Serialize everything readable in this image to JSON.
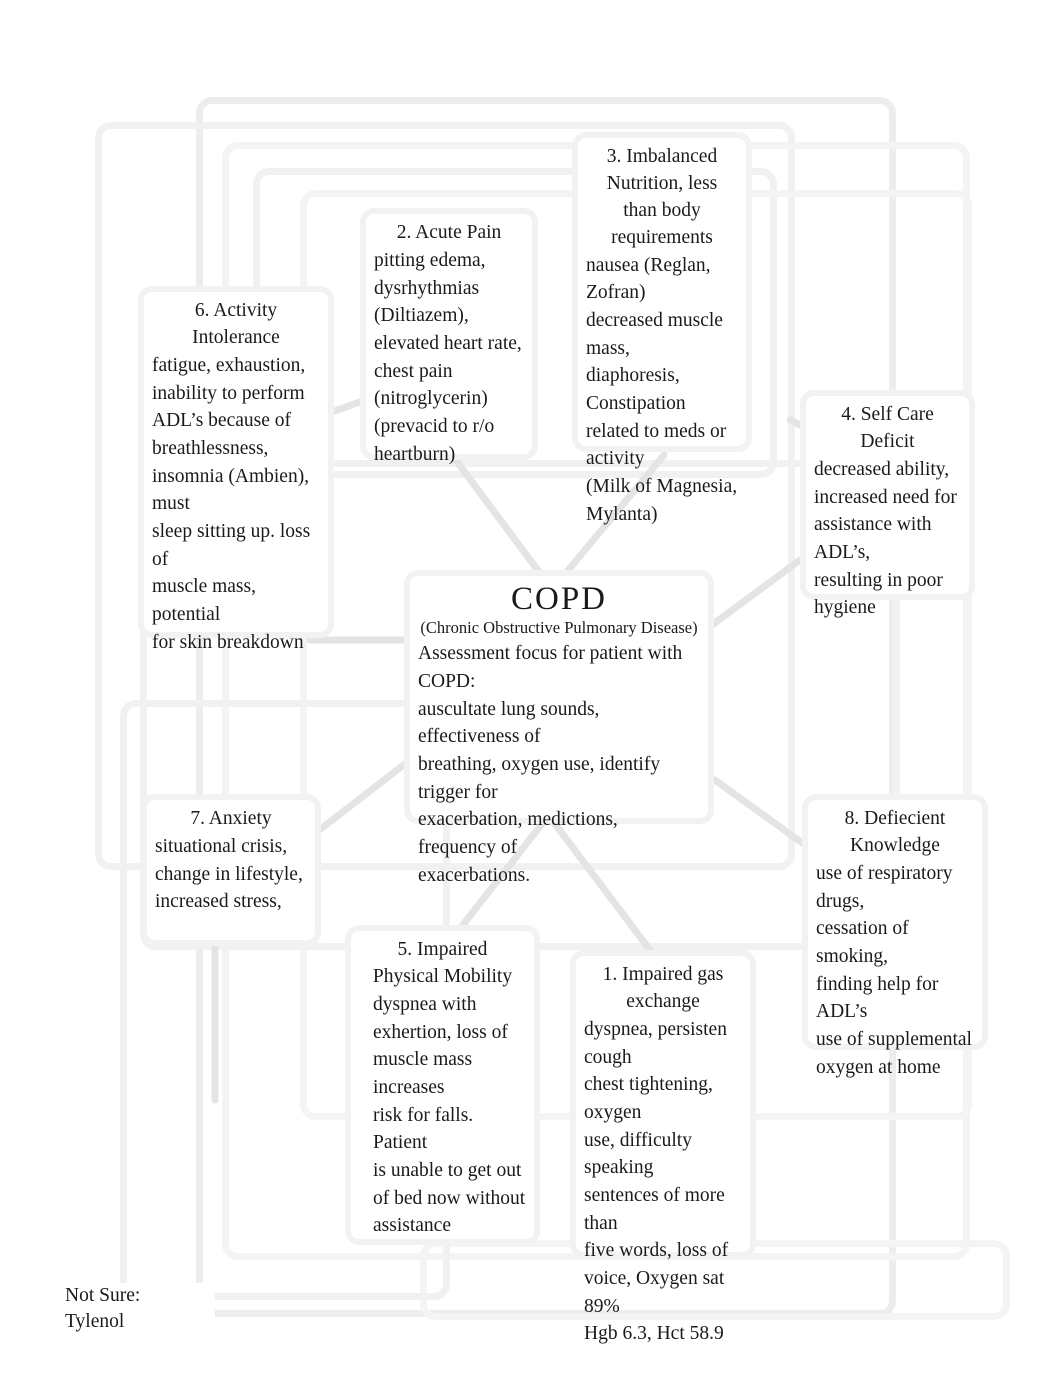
{
  "document": {
    "kind": "concept-map",
    "subject": "COPD nursing concept map"
  },
  "center": {
    "title": "COPD",
    "subtitle": "(Chronic Obstructive Pulmonary Disease)",
    "body": "Assessment focus for patient with COPD:\nauscultate lung sounds, effectiveness of\nbreathing, oxygen use, identify trigger for\nexacerbation, medictions, frequency of\nexacerbations."
  },
  "nodes": [
    {
      "id": "node-1",
      "number": "1.",
      "title": "1. Impaired gas\nexchange",
      "body": "dyspnea, persisten cough\nchest tightening, oxygen\nuse, difficulty speaking\nsentences of more than\nfive words, loss of\nvoice, Oxygen sat 89%\nHgb 6.3, Hct 58.9"
    },
    {
      "id": "node-2",
      "number": "2.",
      "title": "2. Acute Pain",
      "body": "pitting edema,\ndysrhythmias (Diltiazem),\nelevated heart rate,\nchest pain (nitroglycerin)\n(prevacid to r/o\nheartburn)"
    },
    {
      "id": "node-3",
      "number": "3.",
      "title": "3. Imbalanced\nNutrition, less\nthan body\nrequirements",
      "body": "nausea (Reglan, Zofran)\ndecreased muscle mass,\ndiaphoresis, Constipation\nrelated to meds or activity\n(Milk of Magnesia, Mylanta)"
    },
    {
      "id": "node-4",
      "number": "4.",
      "title": "4. Self Care\nDeficit",
      "body": "decreased ability,\nincreased need for\nassistance with ADL’s,\nresulting in poor hygiene"
    },
    {
      "id": "node-5",
      "number": "5.",
      "title": "5. Impaired\nPhysical Mobility",
      "body": "dyspnea with\nexhertion, loss of\nmuscle mass increases\nrisk for falls. Patient\nis unable to get out\nof bed now without\nassistance"
    },
    {
      "id": "node-6",
      "number": "6.",
      "title": "6. Activity\nIntolerance",
      "body": "fatigue, exhaustion,\ninability to perform\nADL’s because of\nbreathlessness,\ninsomnia (Ambien), must\nsleep sitting up. loss of\nmuscle mass, potential\nfor skin breakdown"
    },
    {
      "id": "node-7",
      "number": "7.",
      "title": "7. Anxiety",
      "body": "situational crisis,\nchange in lifestyle,\nincreased stress,"
    },
    {
      "id": "node-8",
      "number": "8.",
      "title": "8. Defiecient\nKnowledge",
      "body": "use of respiratory drugs,\ncessation of smoking,\nfinding help for ADL’s\nuse of supplemental\noxygen at home"
    }
  ],
  "annotations": {
    "not_sure": "Not Sure:\nTylenol"
  },
  "colors": {
    "text": "#1a1a1a",
    "box_border": "#f2f2f2",
    "frame_border": "#ededed",
    "connector": "#e4e4e4",
    "background": "#ffffff"
  }
}
